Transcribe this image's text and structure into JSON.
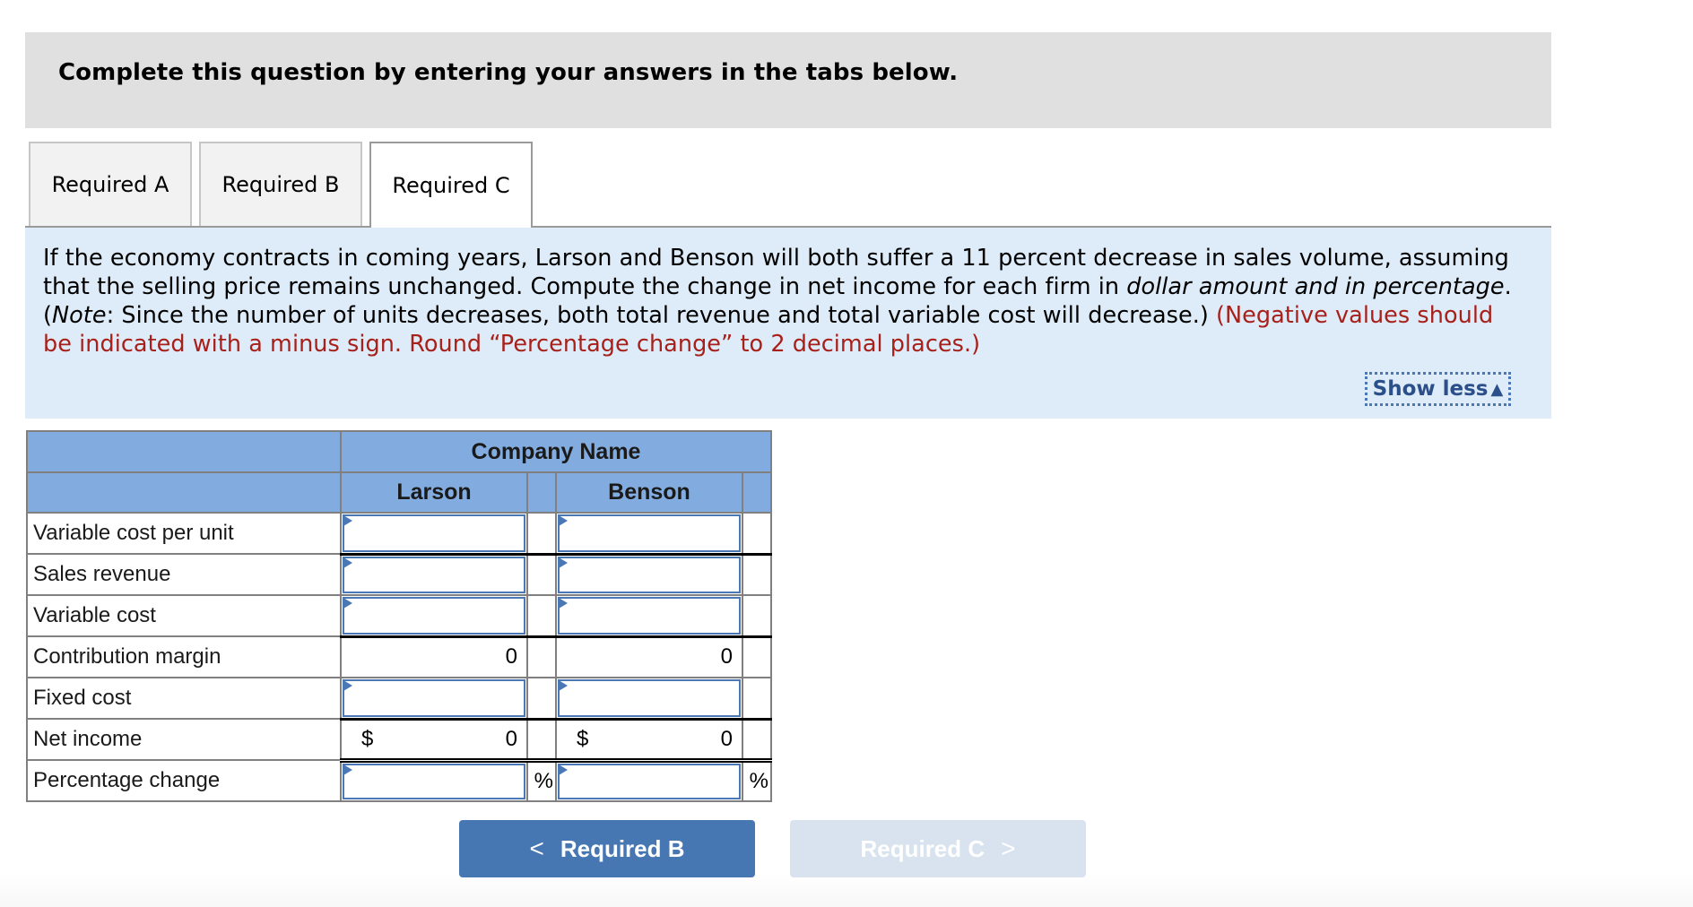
{
  "header": {
    "title": "Complete this question by entering your answers in the tabs below."
  },
  "tabs": [
    {
      "label": "Required A",
      "active": false
    },
    {
      "label": "Required B",
      "active": false
    },
    {
      "label": "Required C",
      "active": true
    }
  ],
  "instructions": {
    "part1": "If the economy contracts in coming years, Larson and Benson will both suffer a 11 percent decrease in sales volume, assuming that the selling price remains unchanged. Compute the change in net income for each firm in ",
    "italic1": "dollar amount and in percentage",
    "part2": ". (",
    "italic2": "Note",
    "part3": ": Since the number of units decreases, both total revenue and total variable cost will decrease.) ",
    "red": "(Negative values should be indicated with a minus sign. Round “Percentage change” to 2 decimal places.)",
    "show_less_label": "Show less",
    "show_less_icon": "triangle-up-icon"
  },
  "table": {
    "group_header": "Company Name",
    "columns": [
      "Larson",
      "Benson"
    ],
    "rows": [
      {
        "label": "Variable cost per unit",
        "larson": "",
        "benson": "",
        "editable": true
      },
      {
        "label": "Sales revenue",
        "larson": "",
        "benson": "",
        "editable": true
      },
      {
        "label": "Variable cost",
        "larson": "",
        "benson": "",
        "editable": true
      },
      {
        "label": "Contribution margin",
        "larson": "0",
        "benson": "0",
        "editable": false
      },
      {
        "label": "Fixed cost",
        "larson": "",
        "benson": "",
        "editable": true
      },
      {
        "label": "Net income",
        "currency": "$",
        "larson": "0",
        "benson": "0",
        "editable": false
      },
      {
        "label": "Percentage change",
        "larson": "",
        "benson": "",
        "suffix": "%",
        "editable": true
      }
    ]
  },
  "nav": {
    "prev_label": "Required B",
    "prev_icon": "chevron-left-icon",
    "next_label": "Required C",
    "next_icon": "chevron-right-icon",
    "next_disabled": true
  },
  "colors": {
    "header_blue": "#82acdf",
    "input_border": "#4a78b4",
    "instruction_bg": "#deebf8",
    "note_red": "#a8201a",
    "prev_button": "#4777b2",
    "next_button_disabled": "#d9e3ef"
  }
}
